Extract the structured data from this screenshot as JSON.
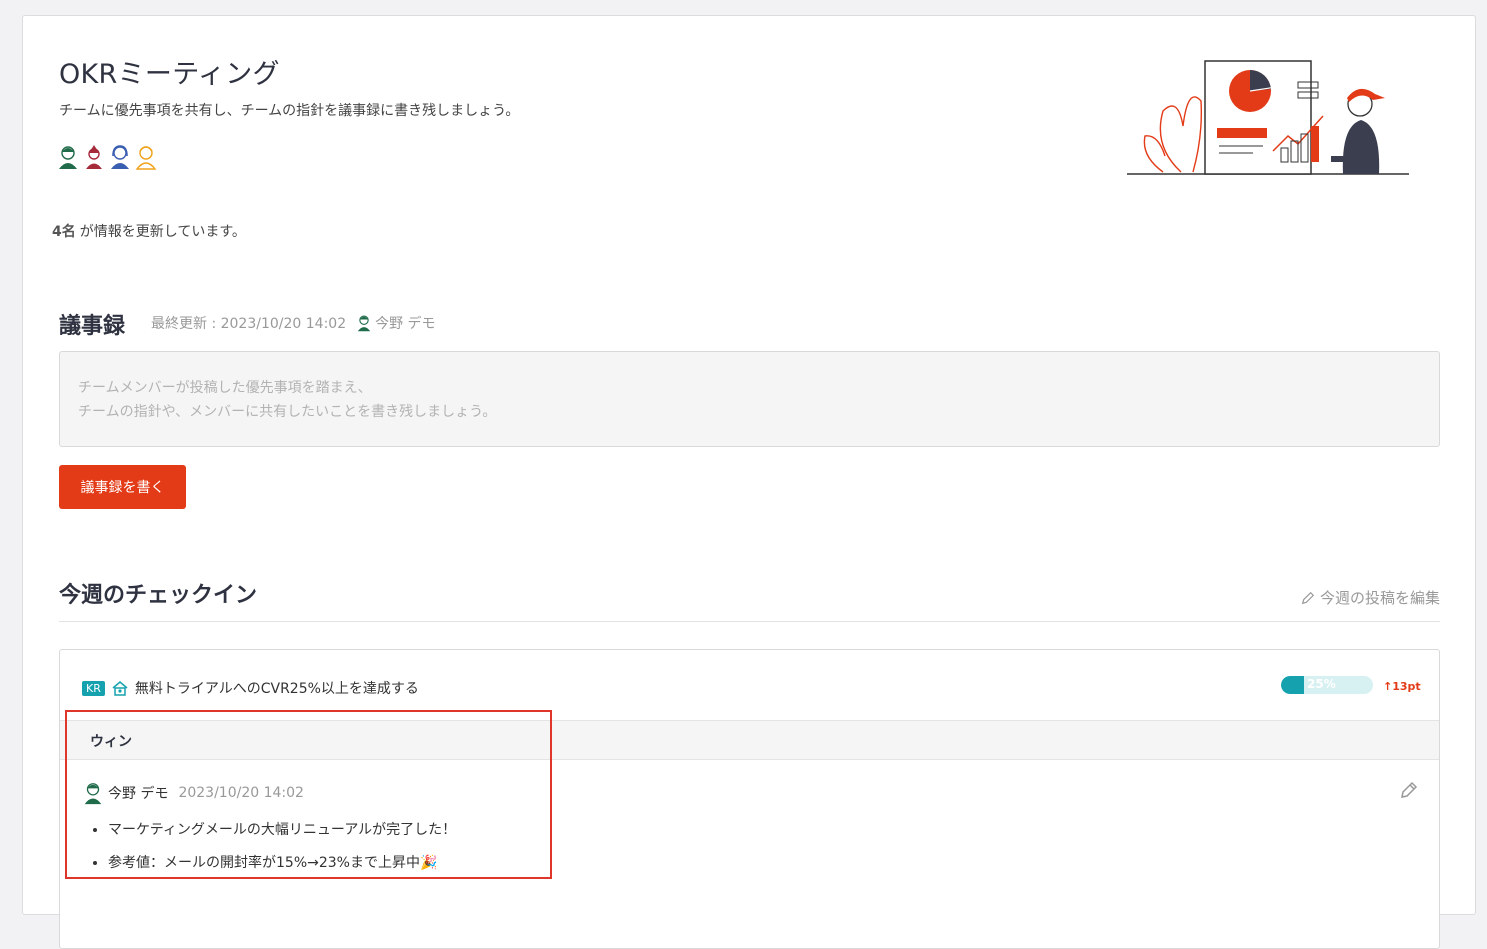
{
  "header": {
    "title": "OKRミーティング",
    "description": "チームに優先事項を共有し、チームの指針を議事録に書き残しましょう。",
    "avatars": [
      "avatar-green",
      "avatar-red",
      "avatar-blue",
      "avatar-orange"
    ],
    "updating_count": "4名",
    "updating_text": "が情報を更新しています。"
  },
  "minutes": {
    "title": "議事録",
    "last_updated": "最終更新 : 2023/10/20 14:02",
    "author": "今野 デモ",
    "placeholder_line1": "チームメンバーが投稿した優先事項を踏まえ、",
    "placeholder_line2": "チームの指針や、メンバーに共有したいことを書き残しましょう。",
    "write_button": "議事録を書く"
  },
  "checkin": {
    "title": "今週のチェックイン",
    "edit_link": "今週の投稿を編集",
    "kr": {
      "badge": "KR",
      "title": "無料トライアルへのCVR25%以上を達成する",
      "progress_percent": 25,
      "progress_label": "25%",
      "delta": "13pt"
    },
    "section": {
      "title": "ウィン",
      "author": "今野 デモ",
      "timestamp": "2023/10/20 14:02",
      "items": [
        "マーケティングメールの大幅リニューアルが完了した！",
        "参考値：メールの開封率が15%→23%まで上昇中🎉"
      ]
    }
  },
  "colors": {
    "accent": "#e33b17",
    "teal": "#15a2ae",
    "highlight": "#e0352b"
  }
}
